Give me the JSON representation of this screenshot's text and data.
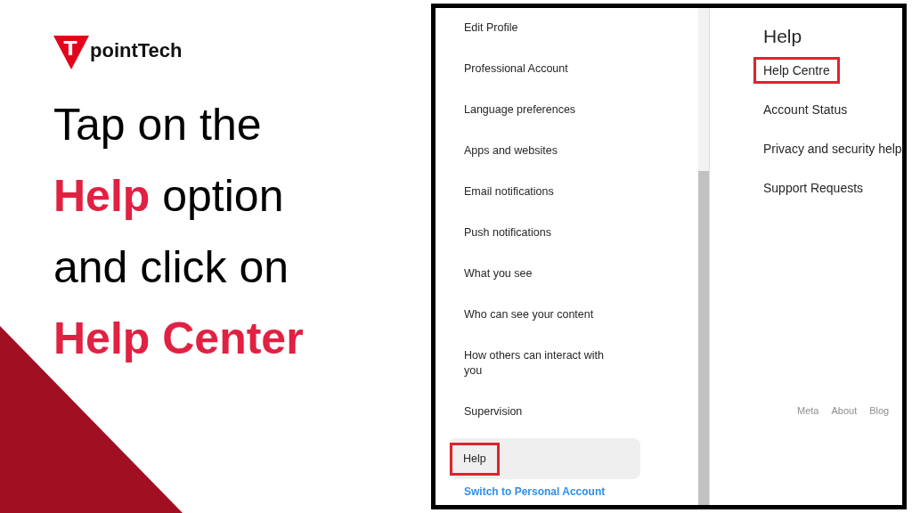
{
  "logo": {
    "mark": "T",
    "text": "pointTech"
  },
  "heading": "Tap on the\n**Help** option\nand click on\n**Help Center**",
  "settings_menu": {
    "items": [
      {
        "label": "Edit Profile",
        "kind": "item",
        "selected": false,
        "highlighted": false
      },
      {
        "label": "Professional Account",
        "kind": "item",
        "selected": false,
        "highlighted": false
      },
      {
        "label": "Language preferences",
        "kind": "item",
        "selected": false,
        "highlighted": false
      },
      {
        "label": "Apps and websites",
        "kind": "item",
        "selected": false,
        "highlighted": false
      },
      {
        "label": "Email notifications",
        "kind": "item",
        "selected": false,
        "highlighted": false
      },
      {
        "label": "Push notifications",
        "kind": "item",
        "selected": false,
        "highlighted": false
      },
      {
        "label": "What you see",
        "kind": "item",
        "selected": false,
        "highlighted": false
      },
      {
        "label": "Who can see your content",
        "kind": "item",
        "selected": false,
        "highlighted": false
      },
      {
        "label": "How others can interact with you",
        "kind": "item",
        "selected": false,
        "highlighted": false
      },
      {
        "label": "Supervision",
        "kind": "item",
        "selected": false,
        "highlighted": false
      },
      {
        "label": "Help",
        "kind": "item",
        "selected": true,
        "highlighted": true
      },
      {
        "label": "Switch to Personal Account",
        "kind": "link",
        "selected": false,
        "highlighted": false
      }
    ]
  },
  "help_panel": {
    "title": "Help",
    "items": [
      {
        "label": "Help Centre",
        "highlighted": true
      },
      {
        "label": "Account Status",
        "highlighted": false
      },
      {
        "label": "Privacy and security help",
        "highlighted": false
      },
      {
        "label": "Support Requests",
        "highlighted": false
      }
    ]
  },
  "footer_links": [
    "Meta",
    "About",
    "Blog"
  ]
}
